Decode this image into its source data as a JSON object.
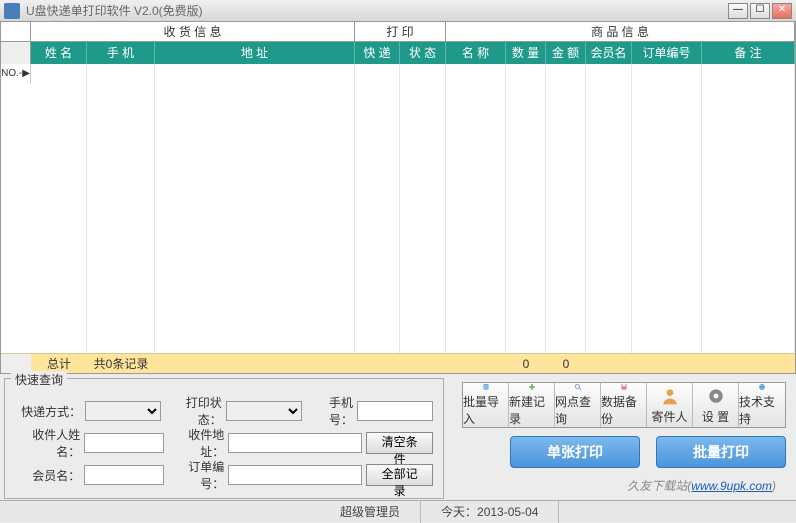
{
  "window": {
    "title": "U盘快递单打印软件 V2.0(免费版)"
  },
  "groups": {
    "receive": "收 货 信 息",
    "print": "打 印",
    "goods": "商 品 信 息"
  },
  "cols": {
    "name": "姓 名",
    "phone": "手 机",
    "address": "地 址",
    "courier": "快 递",
    "status": "状 态",
    "gname": "名 称",
    "qty": "数 量",
    "amount": "金 额",
    "member": "会员名",
    "orderno": "订单编号",
    "remark": "备 注"
  },
  "rowhead_first": "NO.-▶",
  "total": {
    "label": "总计",
    "summary": "共0条记录",
    "qty": "0",
    "amount": "0"
  },
  "query": {
    "title": "快速查询",
    "courier_method": "快递方式：",
    "print_status": "打印状态：",
    "phone": "手机号：",
    "recv_name": "收件人姓名：",
    "recv_addr": "收件地址：",
    "clear": "清空条件",
    "member": "会员名：",
    "orderno": "订单编号：",
    "all": "全部记录"
  },
  "toolbar": {
    "import": "批量导入",
    "new": "新建记录",
    "lookup": "网点查询",
    "backup": "数据备份",
    "sender": "寄件人",
    "settings": "设 置",
    "support": "技术支持"
  },
  "bigbuttons": {
    "single": "单张打印",
    "batch": "批量打印"
  },
  "status": {
    "user": "超级管理员",
    "today_label": "今天：",
    "today": "2013-05-04"
  },
  "watermark": {
    "text": "久友下载站(",
    "url": "www.9upk.com",
    "suffix": ")"
  }
}
